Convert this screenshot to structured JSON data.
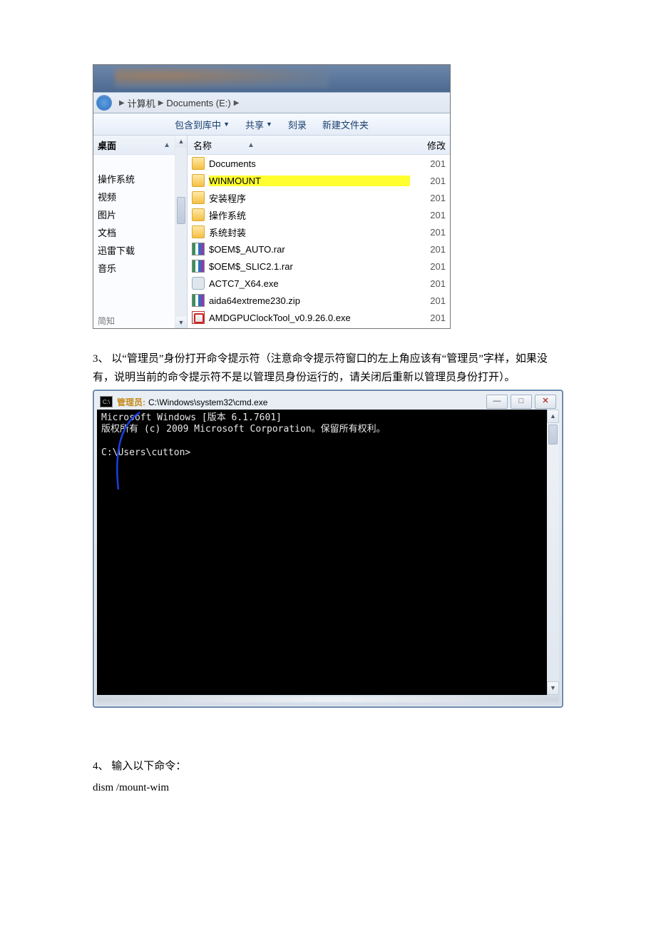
{
  "explorer": {
    "breadcrumb": {
      "seg1": "计算机",
      "seg2": "Documents (E:)"
    },
    "toolbar": {
      "include": "包含到库中",
      "share": "共享",
      "burn": "刻录",
      "newfolder": "新建文件夹"
    },
    "nav": {
      "header": "桌面",
      "items": [
        "",
        "操作系统",
        "视频",
        "图片",
        "文档",
        "迅雷下载",
        "音乐"
      ],
      "bottom": "简知"
    },
    "cols": {
      "name": "名称",
      "mod": "修改"
    },
    "files": [
      {
        "icon": "folder",
        "name": "Documents",
        "date": "201",
        "hl": false
      },
      {
        "icon": "folder",
        "name": "WINMOUNT",
        "date": "201",
        "hl": true
      },
      {
        "icon": "folder",
        "name": "安装程序",
        "date": "201",
        "hl": false
      },
      {
        "icon": "folder",
        "name": "操作系统",
        "date": "201",
        "hl": false
      },
      {
        "icon": "folder",
        "name": "系统封装",
        "date": "201",
        "hl": false
      },
      {
        "icon": "rar",
        "name": "$OEM$_AUTO.rar",
        "date": "201",
        "hl": false
      },
      {
        "icon": "rar",
        "name": "$OEM$_SLIC2.1.rar",
        "date": "201",
        "hl": false
      },
      {
        "icon": "exe",
        "name": "ACTC7_X64.exe",
        "date": "201",
        "hl": false
      },
      {
        "icon": "rar",
        "name": "aida64extreme230.zip",
        "date": "201",
        "hl": false
      },
      {
        "icon": "app",
        "name": "AMDGPUClockTool_v0.9.26.0.exe",
        "date": "201",
        "hl": false
      }
    ]
  },
  "article": {
    "p1": "3、 以“管理员”身份打开命令提示符（注意命令提示符窗口的左上角应该有“管理员”字样，如果没有，说明当前的命令提示符不是以管理员身份运行的，请关闭后重新以管理员身份打开）。",
    "p2": "4、 输入以下命令：",
    "p3": "dism /mount-wim"
  },
  "cmd": {
    "title_admin": "管理员:",
    "title_path": "C:\\Windows\\system32\\cmd.exe",
    "line1": "Microsoft Windows [版本 6.1.7601]",
    "line2": "版权所有 (c) 2009 Microsoft Corporation。保留所有权利。",
    "prompt": "C:\\Users\\cutton>"
  }
}
